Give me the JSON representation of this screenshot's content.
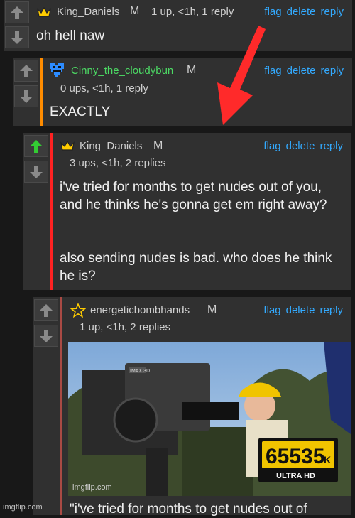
{
  "colors": {
    "accent_c2": "#ff8c00",
    "accent_c3": "#ff2222",
    "accent_c4": "#aa4a44",
    "link": "#33aaff",
    "upvote_active": "#33cc33"
  },
  "icons": {
    "upvote": "up-arrow-icon",
    "downvote": "down-arrow-icon",
    "crown": "crown-icon",
    "pixel_heart": "pixel-heart-icon",
    "star": "star-icon",
    "overlay_arrow": "red-arrow-icon"
  },
  "actions": {
    "flag": "flag",
    "delete": "delete",
    "reply": "reply"
  },
  "comments": [
    {
      "username": "King_Daniels",
      "mod": "M",
      "info": "1 up, <1h, 1 reply",
      "body": "oh hell naw"
    },
    {
      "username": "Cinny_the_cloudybun",
      "mod": "M",
      "info": "0 ups, <1h, 1 reply",
      "body": "EXACTLY"
    },
    {
      "username": "King_Daniels",
      "mod": "M",
      "info": "3 ups, <1h, 2 replies",
      "body_p1": "i've tried for months to get nudes out of you, and he thinks he's gonna get em right away?",
      "body_p2": "also sending nudes is bad. who does he think he is?"
    },
    {
      "username": "energeticbombhands",
      "mod": "M",
      "info": "1 up, <1h, 2 replies",
      "image": {
        "camera_label": "IMAX 3D",
        "badge_number": "65535",
        "badge_suffix": "K",
        "badge_sub": "ULTRA HD",
        "watermark": "imgflip.com"
      },
      "body": "\"i've tried for months to get nudes out of"
    }
  ],
  "footer_watermark": "imgflip.com"
}
